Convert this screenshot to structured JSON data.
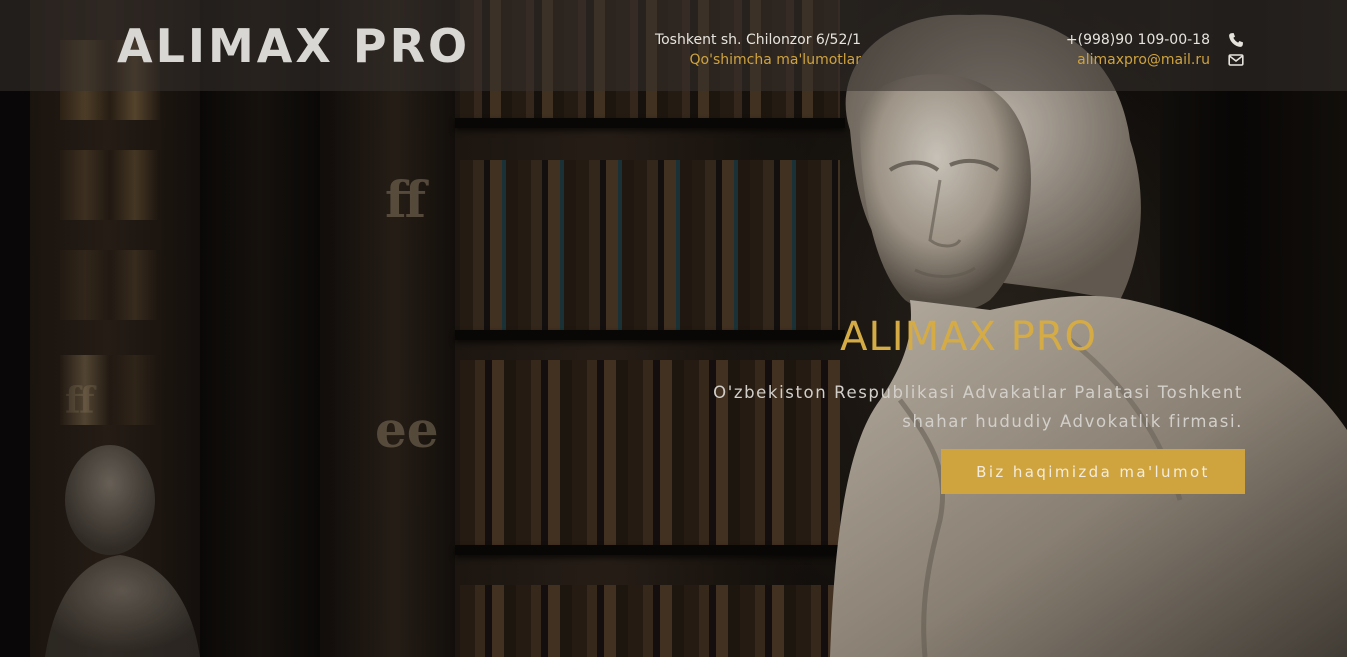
{
  "header": {
    "logo": "ALIMAX PRO",
    "address": "Toshkent sh. Chilonzor 6/52/1",
    "more_info_link": "Qo'shimcha ma'lumotlar",
    "phone": "+(998)90 109-00-18",
    "email": "alimaxpro@mail.ru",
    "phone_icon": "phone-icon",
    "email_icon": "envelope-icon"
  },
  "hero": {
    "title": "ALIMAX PRO",
    "subtitle": "O'zbekiston Respublikasi Advakatlar Palatasi Toshkent shahar hududiy Advokatlik firmasi.",
    "button_label": "Biz haqimizda ma'lumot"
  },
  "colors": {
    "accent": "#cfa33e",
    "header_bg": "#37322d",
    "logo_text": "#d9d7d3"
  }
}
